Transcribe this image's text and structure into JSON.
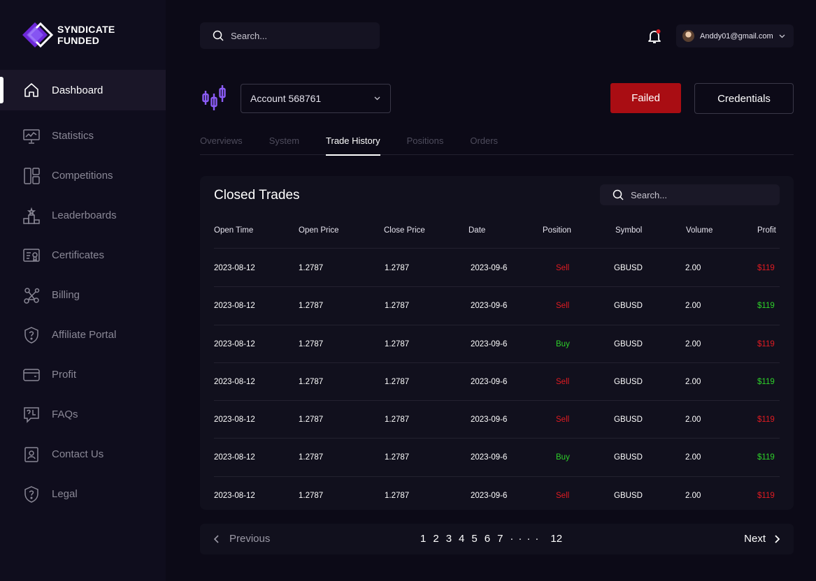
{
  "brand": {
    "line1": "SYNDICATE",
    "line2": "FUNDED"
  },
  "sidebar": {
    "items": [
      {
        "label": "Dashboard",
        "icon": "home-icon",
        "active": true
      },
      {
        "label": "Statistics",
        "icon": "presentation-chart-icon"
      },
      {
        "label": "Competitions",
        "icon": "layout-grid-icon"
      },
      {
        "label": "Leaderboards",
        "icon": "podium-icon"
      },
      {
        "label": "Certificates",
        "icon": "certificate-icon"
      },
      {
        "label": "Billing",
        "icon": "nodes-icon"
      },
      {
        "label": "Affiliate Portal",
        "icon": "shield-question-icon"
      },
      {
        "label": "Profit",
        "icon": "wallet-icon"
      },
      {
        "label": "FAQs",
        "icon": "chat-question-icon"
      },
      {
        "label": "Contact Us",
        "icon": "contact-card-icon"
      },
      {
        "label": "Legal",
        "icon": "shield-question-icon"
      }
    ]
  },
  "header": {
    "search_placeholder": "Search...",
    "user_email": "Anddy01@gmail.com"
  },
  "account": {
    "selected": "Account 568761",
    "status_button": "Failed",
    "credentials_button": "Credentials"
  },
  "tabs": [
    {
      "label": "Overviews"
    },
    {
      "label": "System"
    },
    {
      "label": "Trade History",
      "active": true
    },
    {
      "label": "Positions"
    },
    {
      "label": "Orders"
    }
  ],
  "table": {
    "title": "Closed Trades",
    "search_placeholder": "Search...",
    "columns": [
      "Open Time",
      "Open Price",
      "Close Price",
      "Date",
      "Position",
      "Symbol",
      "Volume",
      "Profit"
    ],
    "rows": [
      {
        "open_time": "2023-08-12",
        "open_price": "1.2787",
        "close_price": "1.2787",
        "date": "2023-09-6",
        "position": "Sell",
        "symbol": "GBUSD",
        "volume": "2.00",
        "profit": "$119",
        "profit_sign": "neg"
      },
      {
        "open_time": "2023-08-12",
        "open_price": "1.2787",
        "close_price": "1.2787",
        "date": "2023-09-6",
        "position": "Sell",
        "symbol": "GBUSD",
        "volume": "2.00",
        "profit": "$119",
        "profit_sign": "pos"
      },
      {
        "open_time": "2023-08-12",
        "open_price": "1.2787",
        "close_price": "1.2787",
        "date": "2023-09-6",
        "position": "Buy",
        "symbol": "GBUSD",
        "volume": "2.00",
        "profit": "$119",
        "profit_sign": "neg"
      },
      {
        "open_time": "2023-08-12",
        "open_price": "1.2787",
        "close_price": "1.2787",
        "date": "2023-09-6",
        "position": "Sell",
        "symbol": "GBUSD",
        "volume": "2.00",
        "profit": "$119",
        "profit_sign": "pos"
      },
      {
        "open_time": "2023-08-12",
        "open_price": "1.2787",
        "close_price": "1.2787",
        "date": "2023-09-6",
        "position": "Sell",
        "symbol": "GBUSD",
        "volume": "2.00",
        "profit": "$119",
        "profit_sign": "neg"
      },
      {
        "open_time": "2023-08-12",
        "open_price": "1.2787",
        "close_price": "1.2787",
        "date": "2023-09-6",
        "position": "Buy",
        "symbol": "GBUSD",
        "volume": "2.00",
        "profit": "$119",
        "profit_sign": "pos"
      },
      {
        "open_time": "2023-08-12",
        "open_price": "1.2787",
        "close_price": "1.2787",
        "date": "2023-09-6",
        "position": "Sell",
        "symbol": "GBUSD",
        "volume": "2.00",
        "profit": "$119",
        "profit_sign": "neg"
      }
    ]
  },
  "pagination": {
    "previous": "Previous",
    "next": "Next",
    "pages": [
      "1",
      "2",
      "3",
      "4",
      "5",
      "6",
      "7"
    ],
    "ellipsis": "····",
    "last": "12"
  },
  "colors": {
    "background": "#0c0a17",
    "sidebar": "#0f0d1d",
    "accent_purple": "#8b5cf6",
    "failed_red": "#a90d13",
    "sell_red": "#e01b22",
    "buy_green": "#2ed12a"
  }
}
